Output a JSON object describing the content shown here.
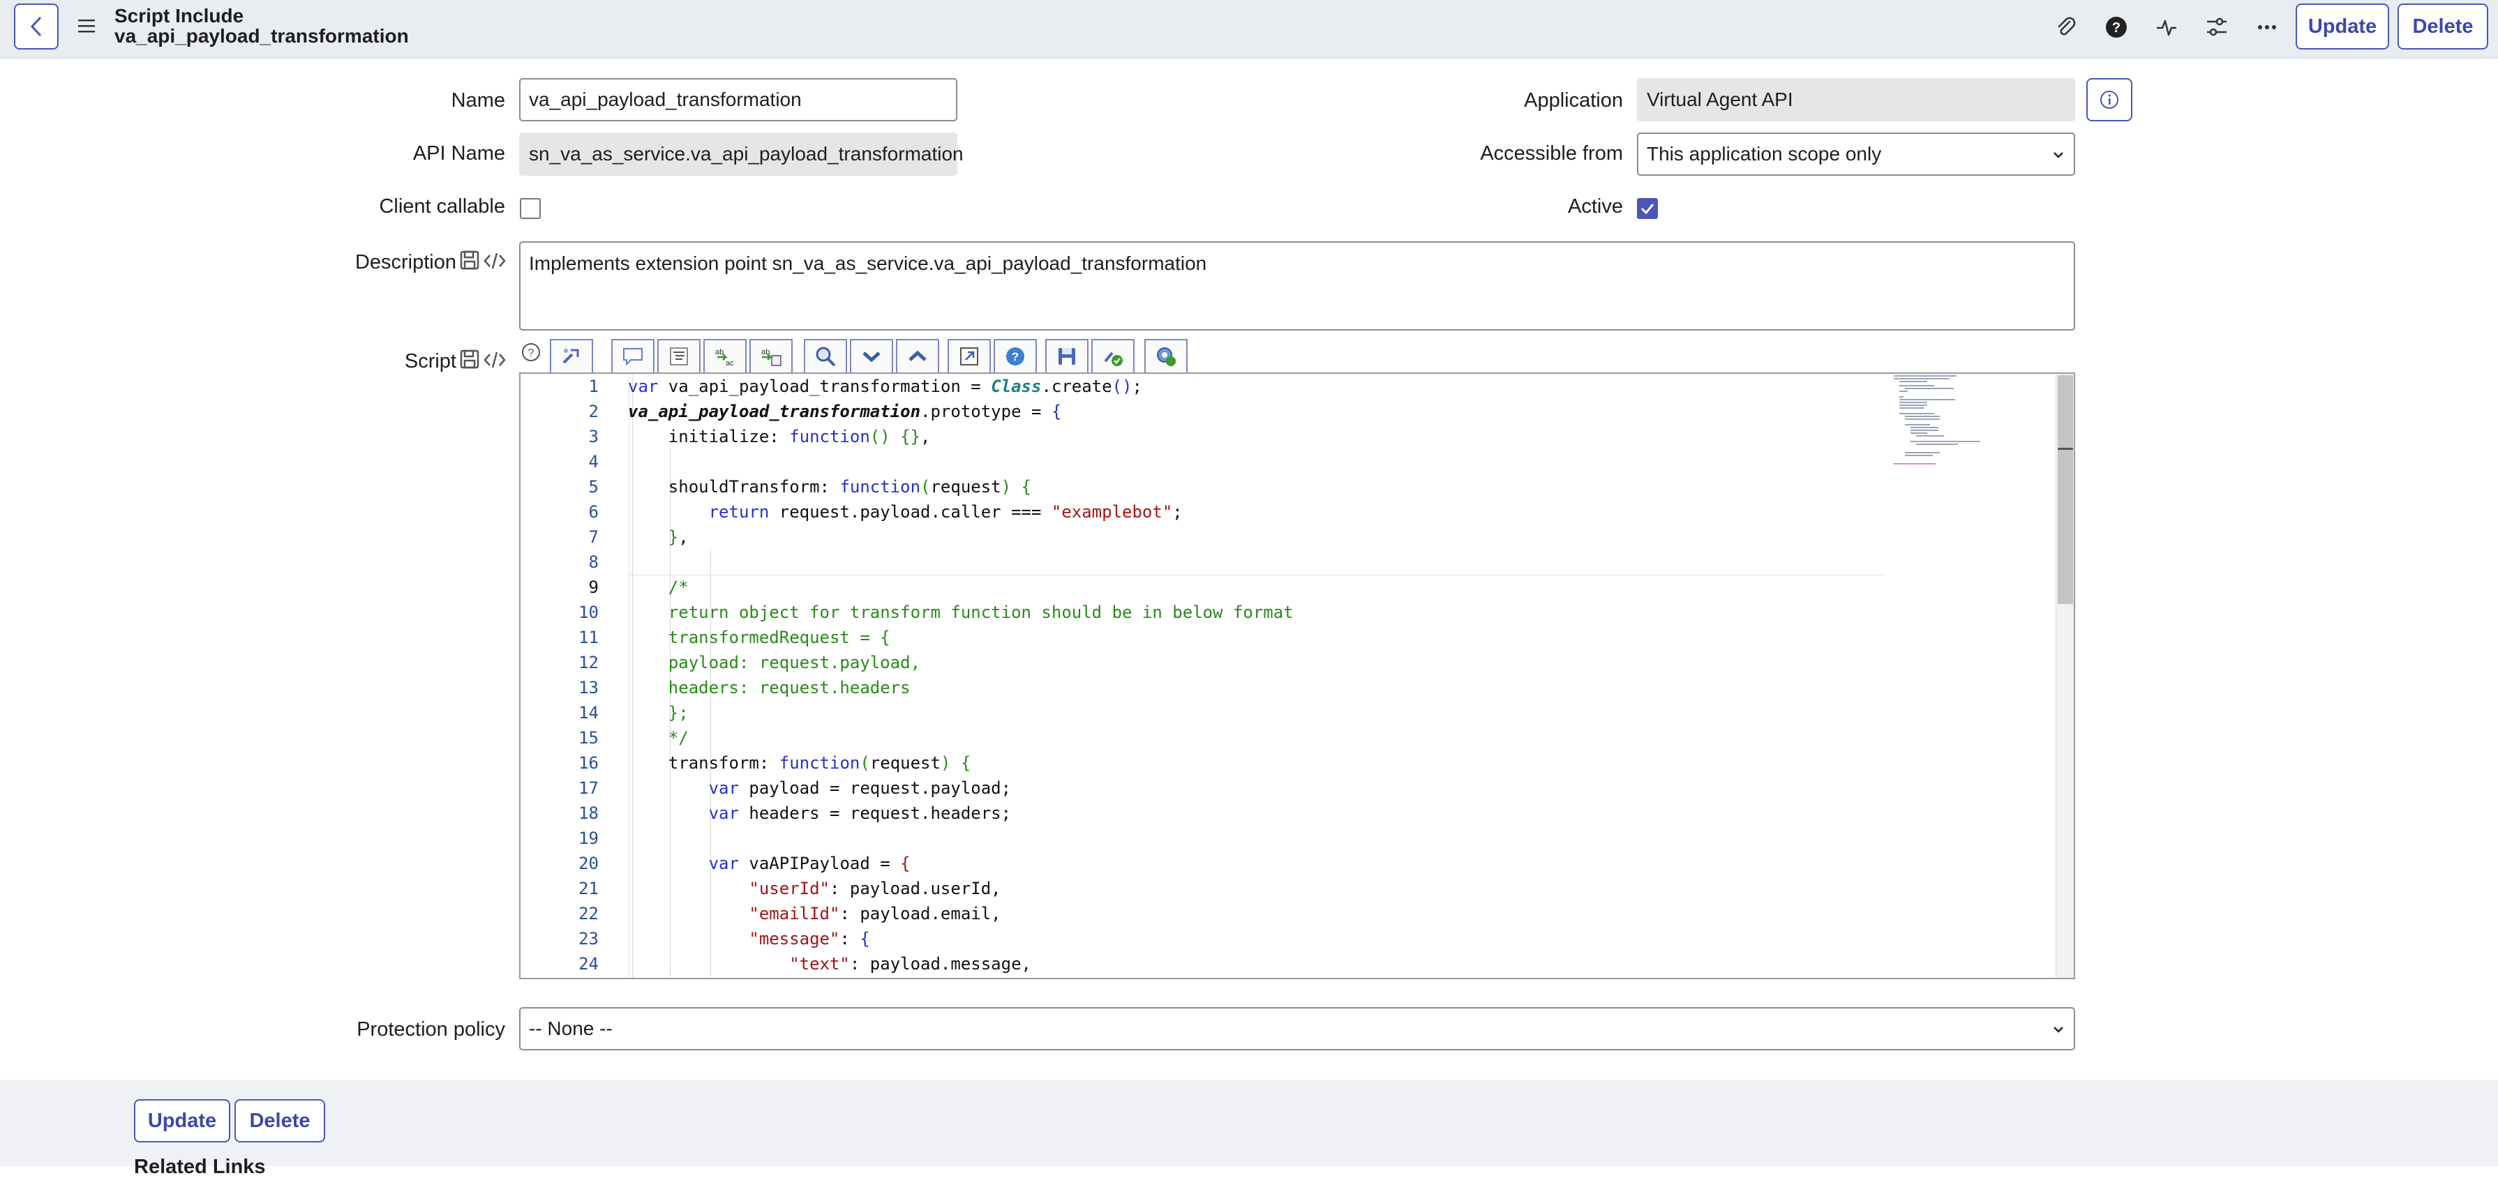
{
  "header": {
    "title": "Script Include",
    "record": "va_api_payload_transformation",
    "update_label": "Update",
    "delete_label": "Delete"
  },
  "form": {
    "name_label": "Name",
    "name_value": "va_api_payload_transformation",
    "api_name_label": "API Name",
    "api_name_value": "sn_va_as_service.va_api_payload_transformation",
    "client_callable_label": "Client callable",
    "client_callable_checked": false,
    "description_label": "Description",
    "description_value": "Implements extension point sn_va_as_service.va_api_payload_transformation",
    "application_label": "Application",
    "application_value": "Virtual Agent API",
    "accessible_label": "Accessible from",
    "accessible_value": "This application scope only",
    "active_label": "Active",
    "active_checked": true,
    "script_label": "Script",
    "protection_label": "Protection policy",
    "protection_value": "-- None --"
  },
  "script": {
    "lines": [
      "1",
      "2",
      "3",
      "4",
      "5",
      "6",
      "7",
      "8",
      "9",
      "10",
      "11",
      "12",
      "13",
      "14",
      "15",
      "16",
      "17",
      "18",
      "19",
      "20",
      "21",
      "22",
      "23",
      "24"
    ],
    "active_line": 9
  },
  "footer": {
    "update_label": "Update",
    "delete_label": "Delete",
    "related_partial": "Related Links"
  },
  "colors": {
    "accent": "#4a57b8",
    "header_bg": "#e9ecf1",
    "keyword": "#2433c9",
    "string": "#a31515",
    "comment": "#2a8a1a"
  },
  "icons": [
    "back-icon",
    "menu-icon",
    "paperclip-icon",
    "help-icon",
    "activity-icon",
    "settings-sliders-icon",
    "more-icon",
    "info-icon",
    "save-icon",
    "code-icon",
    "script-help-icon",
    "toggle-syntax-icon",
    "comment-icon",
    "format-icon",
    "replace-icon",
    "replace-all-icon",
    "search-icon",
    "next-icon",
    "previous-icon",
    "fullscreen-icon",
    "help-circle-icon",
    "save-script-icon",
    "syntax-check-icon",
    "debug-icon"
  ]
}
